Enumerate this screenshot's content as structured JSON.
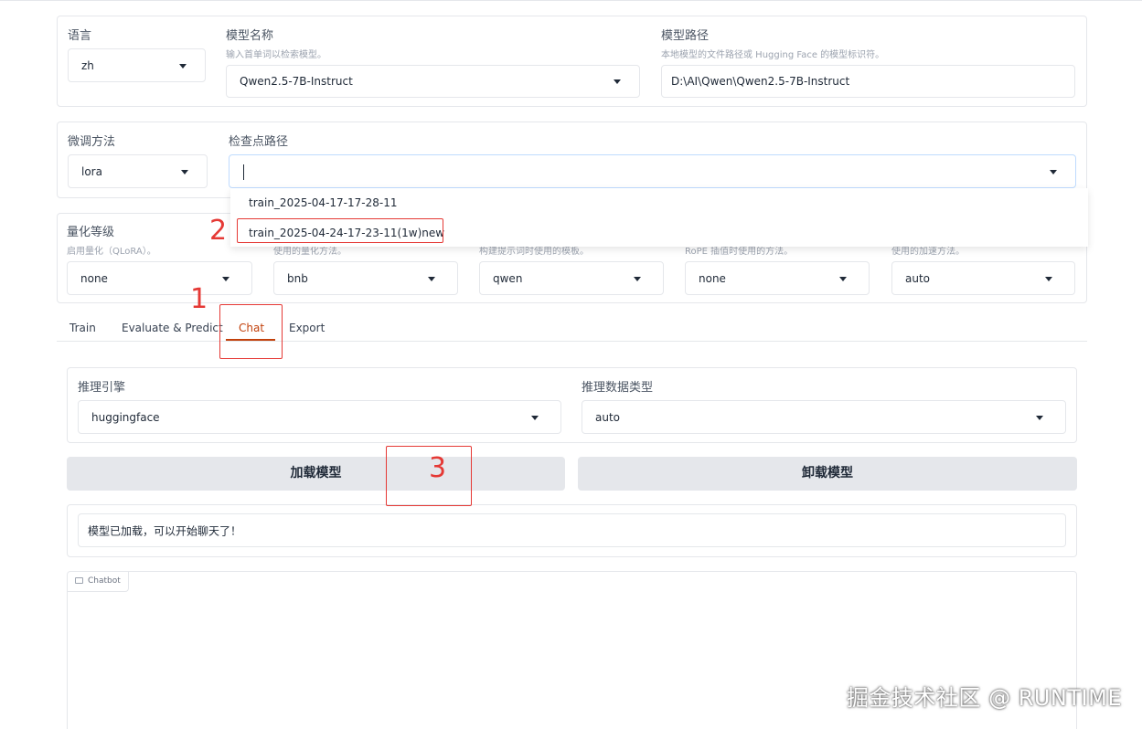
{
  "lang": {
    "label": "语言",
    "value": "zh"
  },
  "model_name": {
    "label": "模型名称",
    "hint": "输入首单词以检索模型。",
    "value": "Qwen2.5-7B-Instruct"
  },
  "model_path": {
    "label": "模型路径",
    "hint": "本地模型的文件路径或 Hugging Face 的模型标识符。",
    "value": "D:\\AI\\Qwen\\Qwen2.5-7B-Instruct"
  },
  "finetune": {
    "label": "微调方法",
    "value": "lora"
  },
  "checkpoint": {
    "label": "检查点路径",
    "value": "",
    "options": [
      "train_2025-04-17-17-28-11",
      "train_2025-04-24-17-23-11(1w)new"
    ]
  },
  "quant": {
    "label": "量化等级",
    "hint": "启用量化（QLoRA）。",
    "hint2": "使用的量化方法。",
    "hint3": "构建提示词时使用的模板。",
    "hint4": "RoPE 插值时使用的方法。",
    "hint5": "使用的加速方法。",
    "values": [
      "none",
      "bnb",
      "qwen",
      "none",
      "auto"
    ]
  },
  "tabs": [
    "Train",
    "Evaluate & Predict",
    "Chat",
    "Export"
  ],
  "chat": {
    "engine_label": "推理引擎",
    "engine_value": "huggingface",
    "dtype_label": "推理数据类型",
    "dtype_value": "auto",
    "load_button": "加载模型",
    "unload_button": "卸载模型",
    "status": "模型已加载，可以开始聊天了！",
    "chatbot_label": "Chatbot"
  },
  "annotations": [
    "1",
    "2",
    "3"
  ],
  "watermark": "掘金技术社区 @ RUNTIME",
  "colors": {
    "accent": "#c2410c",
    "annotation": "#e53935",
    "button": "#e5e7eb"
  }
}
